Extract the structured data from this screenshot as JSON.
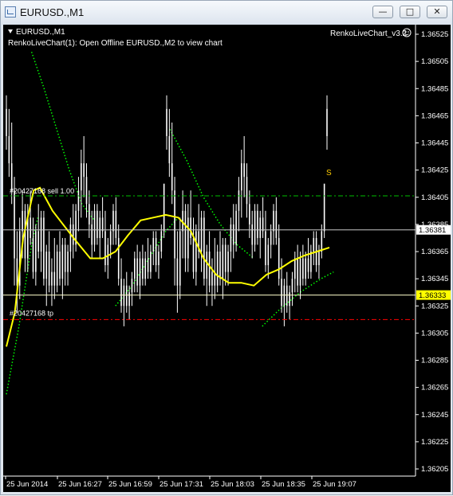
{
  "window": {
    "title": "EURUSD.,M1",
    "minimize_glyph": "—",
    "restore_glyph": "□",
    "close_glyph": "✕"
  },
  "chart": {
    "symbol_label": "EURUSD.,M1",
    "info_text": "RenkoLiveChart(1): Open Offline EURUSD.,M2 to view chart",
    "indicator_name": "RenkoLiveChart_v3.2",
    "sell_label": "#20427168 sell 1.00",
    "tp_label": "#20427168 tp",
    "signal_letter": "S",
    "bid_price": "1.36381",
    "tp_price": "1.36333",
    "colors": {
      "background": "#000000",
      "candle": "#ffffff",
      "ma": "#ffff00",
      "band": "#00ff00",
      "sell_line": "#00c000",
      "tp_line": "#ff0000",
      "bid_line": "#ffffff",
      "signal": "#ffcc00"
    }
  },
  "chart_data": {
    "type": "candlestick",
    "title": "EURUSD.,M1",
    "y_ticks": [
      "1.36525",
      "1.36505",
      "1.36485",
      "1.36465",
      "1.36445",
      "1.36425",
      "1.36405",
      "1.36385",
      "1.36365",
      "1.36345",
      "1.36325",
      "1.36305",
      "1.36285",
      "1.36265",
      "1.36245",
      "1.36225",
      "1.36205"
    ],
    "x_ticks": [
      "25 Jun 2014",
      "25 Jun 16:27",
      "25 Jun 16:59",
      "25 Jun 17:31",
      "25 Jun 18:03",
      "25 Jun 18:35",
      "25 Jun 19:07"
    ],
    "ylim": [
      1.36195,
      1.36535
    ],
    "levels": {
      "sell_entry": 1.36406,
      "take_profit": 1.36315,
      "bid": 1.36381,
      "tp_price_tag": 1.36333
    },
    "ma_line": [
      [
        0,
        1.36295
      ],
      [
        4,
        1.3632
      ],
      [
        8,
        1.36375
      ],
      [
        13,
        1.3641
      ],
      [
        16,
        1.36412
      ],
      [
        22,
        1.36395
      ],
      [
        32,
        1.36375
      ],
      [
        40,
        1.3636
      ],
      [
        46,
        1.3636
      ],
      [
        52,
        1.36365
      ],
      [
        58,
        1.36377
      ],
      [
        64,
        1.36388
      ],
      [
        70,
        1.3639
      ],
      [
        76,
        1.36392
      ],
      [
        82,
        1.3639
      ],
      [
        88,
        1.3638
      ],
      [
        94,
        1.3636
      ],
      [
        100,
        1.36348
      ],
      [
        106,
        1.36342
      ],
      [
        112,
        1.36342
      ],
      [
        118,
        1.3634
      ],
      [
        124,
        1.36348
      ],
      [
        130,
        1.36352
      ],
      [
        136,
        1.36358
      ],
      [
        142,
        1.36362
      ],
      [
        148,
        1.36365
      ],
      [
        154,
        1.36368
      ]
    ],
    "band_upper_1": [
      [
        12,
        1.36512
      ],
      [
        18,
        1.36485
      ],
      [
        24,
        1.36455
      ],
      [
        30,
        1.36425
      ],
      [
        36,
        1.364
      ],
      [
        42,
        1.36388
      ]
    ],
    "band_lower_1": [
      [
        0,
        1.3626
      ],
      [
        3,
        1.36285
      ],
      [
        6,
        1.3631
      ],
      [
        9,
        1.3634
      ],
      [
        12,
        1.3637
      ],
      [
        15,
        1.3639
      ]
    ],
    "band_upper_2": [
      [
        78,
        1.36455
      ],
      [
        86,
        1.36432
      ],
      [
        94,
        1.36405
      ],
      [
        102,
        1.36385
      ],
      [
        110,
        1.3637
      ],
      [
        118,
        1.3636
      ]
    ],
    "band_lower_2": [
      [
        52,
        1.36325
      ],
      [
        60,
        1.3634
      ],
      [
        68,
        1.3636
      ],
      [
        76,
        1.3638
      ],
      [
        82,
        1.3639
      ]
    ],
    "band_lower_3": [
      [
        122,
        1.3631
      ],
      [
        130,
        1.36322
      ],
      [
        140,
        1.36335
      ],
      [
        150,
        1.36345
      ],
      [
        156,
        1.3635
      ]
    ],
    "candles": [
      {
        "o": 1.3647,
        "h": 1.3648,
        "l": 1.3644,
        "c": 1.3645
      },
      {
        "o": 1.3645,
        "h": 1.3647,
        "l": 1.3642,
        "c": 1.3643
      },
      {
        "o": 1.3643,
        "h": 1.3646,
        "l": 1.364,
        "c": 1.3641
      },
      {
        "o": 1.3641,
        "h": 1.3642,
        "l": 1.3634,
        "c": 1.3636
      },
      {
        "o": 1.3636,
        "h": 1.3638,
        "l": 1.3632,
        "c": 1.3634
      },
      {
        "o": 1.3634,
        "h": 1.3639,
        "l": 1.3633,
        "c": 1.3638
      },
      {
        "o": 1.3638,
        "h": 1.3641,
        "l": 1.3636,
        "c": 1.36395
      },
      {
        "o": 1.36395,
        "h": 1.364,
        "l": 1.3635,
        "c": 1.3636
      },
      {
        "o": 1.3636,
        "h": 1.364,
        "l": 1.3635,
        "c": 1.3639
      },
      {
        "o": 1.3639,
        "h": 1.3641,
        "l": 1.3637,
        "c": 1.36375
      },
      {
        "o": 1.36375,
        "h": 1.3639,
        "l": 1.36345,
        "c": 1.3635
      },
      {
        "o": 1.3635,
        "h": 1.36385,
        "l": 1.3634,
        "c": 1.3638
      },
      {
        "o": 1.3638,
        "h": 1.364,
        "l": 1.3636,
        "c": 1.36365
      },
      {
        "o": 1.36365,
        "h": 1.36395,
        "l": 1.3635,
        "c": 1.3639
      },
      {
        "o": 1.3639,
        "h": 1.36395,
        "l": 1.3634,
        "c": 1.36345
      },
      {
        "o": 1.36345,
        "h": 1.3637,
        "l": 1.36325,
        "c": 1.36365
      },
      {
        "o": 1.36365,
        "h": 1.3638,
        "l": 1.36335,
        "c": 1.3634
      },
      {
        "o": 1.3634,
        "h": 1.3636,
        "l": 1.36325,
        "c": 1.3635
      },
      {
        "o": 1.3635,
        "h": 1.36375,
        "l": 1.3633,
        "c": 1.3634
      },
      {
        "o": 1.3634,
        "h": 1.3637,
        "l": 1.36335,
        "c": 1.36365
      },
      {
        "o": 1.36365,
        "h": 1.3638,
        "l": 1.3634,
        "c": 1.36345
      },
      {
        "o": 1.36345,
        "h": 1.36375,
        "l": 1.3633,
        "c": 1.3637
      },
      {
        "o": 1.3637,
        "h": 1.36375,
        "l": 1.3634,
        "c": 1.3635
      },
      {
        "o": 1.3635,
        "h": 1.3637,
        "l": 1.3634,
        "c": 1.36365
      },
      {
        "o": 1.36365,
        "h": 1.3639,
        "l": 1.3635,
        "c": 1.36385
      },
      {
        "o": 1.36385,
        "h": 1.364,
        "l": 1.3636,
        "c": 1.3637
      },
      {
        "o": 1.3637,
        "h": 1.364,
        "l": 1.36365,
        "c": 1.36395
      },
      {
        "o": 1.36395,
        "h": 1.3642,
        "l": 1.3638,
        "c": 1.3641
      },
      {
        "o": 1.3641,
        "h": 1.3644,
        "l": 1.3639,
        "c": 1.3643
      },
      {
        "o": 1.3643,
        "h": 1.3645,
        "l": 1.36405,
        "c": 1.3642
      },
      {
        "o": 1.3642,
        "h": 1.3643,
        "l": 1.3639,
        "c": 1.364
      },
      {
        "o": 1.364,
        "h": 1.3641,
        "l": 1.36375,
        "c": 1.36385
      },
      {
        "o": 1.36385,
        "h": 1.36395,
        "l": 1.3636,
        "c": 1.3637
      },
      {
        "o": 1.3637,
        "h": 1.364,
        "l": 1.36365,
        "c": 1.36395
      },
      {
        "o": 1.36395,
        "h": 1.364,
        "l": 1.3637,
        "c": 1.36375
      },
      {
        "o": 1.36375,
        "h": 1.36395,
        "l": 1.3636,
        "c": 1.3639
      },
      {
        "o": 1.3639,
        "h": 1.36405,
        "l": 1.36375,
        "c": 1.3638
      },
      {
        "o": 1.3638,
        "h": 1.36395,
        "l": 1.3635,
        "c": 1.36355
      },
      {
        "o": 1.36355,
        "h": 1.36375,
        "l": 1.36345,
        "c": 1.3637
      },
      {
        "o": 1.3637,
        "h": 1.36385,
        "l": 1.3636,
        "c": 1.3638
      },
      {
        "o": 1.3638,
        "h": 1.364,
        "l": 1.3637,
        "c": 1.36395
      },
      {
        "o": 1.36395,
        "h": 1.36405,
        "l": 1.3637,
        "c": 1.36375
      },
      {
        "o": 1.36375,
        "h": 1.36385,
        "l": 1.3634,
        "c": 1.36345
      },
      {
        "o": 1.36345,
        "h": 1.3636,
        "l": 1.3632,
        "c": 1.36325
      },
      {
        "o": 1.36325,
        "h": 1.36345,
        "l": 1.3631,
        "c": 1.3634
      },
      {
        "o": 1.3634,
        "h": 1.3635,
        "l": 1.3632,
        "c": 1.36325
      },
      {
        "o": 1.36325,
        "h": 1.3634,
        "l": 1.36315,
        "c": 1.36335
      },
      {
        "o": 1.36335,
        "h": 1.3635,
        "l": 1.36325,
        "c": 1.36345
      },
      {
        "o": 1.36345,
        "h": 1.36365,
        "l": 1.36335,
        "c": 1.3636
      },
      {
        "o": 1.3636,
        "h": 1.3637,
        "l": 1.36335,
        "c": 1.3634
      },
      {
        "o": 1.3634,
        "h": 1.36365,
        "l": 1.3633,
        "c": 1.3636
      },
      {
        "o": 1.3636,
        "h": 1.3637,
        "l": 1.3634,
        "c": 1.36345
      },
      {
        "o": 1.36345,
        "h": 1.36365,
        "l": 1.3634,
        "c": 1.3636
      },
      {
        "o": 1.3636,
        "h": 1.36375,
        "l": 1.36345,
        "c": 1.3635
      },
      {
        "o": 1.3635,
        "h": 1.3637,
        "l": 1.36345,
        "c": 1.36365
      },
      {
        "o": 1.36365,
        "h": 1.3638,
        "l": 1.36355,
        "c": 1.36375
      },
      {
        "o": 1.36375,
        "h": 1.3638,
        "l": 1.3635,
        "c": 1.36355
      },
      {
        "o": 1.36355,
        "h": 1.3637,
        "l": 1.36345,
        "c": 1.36365
      },
      {
        "o": 1.36365,
        "h": 1.36385,
        "l": 1.3636,
        "c": 1.3638
      },
      {
        "o": 1.3638,
        "h": 1.36395,
        "l": 1.36375,
        "c": 1.36415
      }
    ]
  }
}
